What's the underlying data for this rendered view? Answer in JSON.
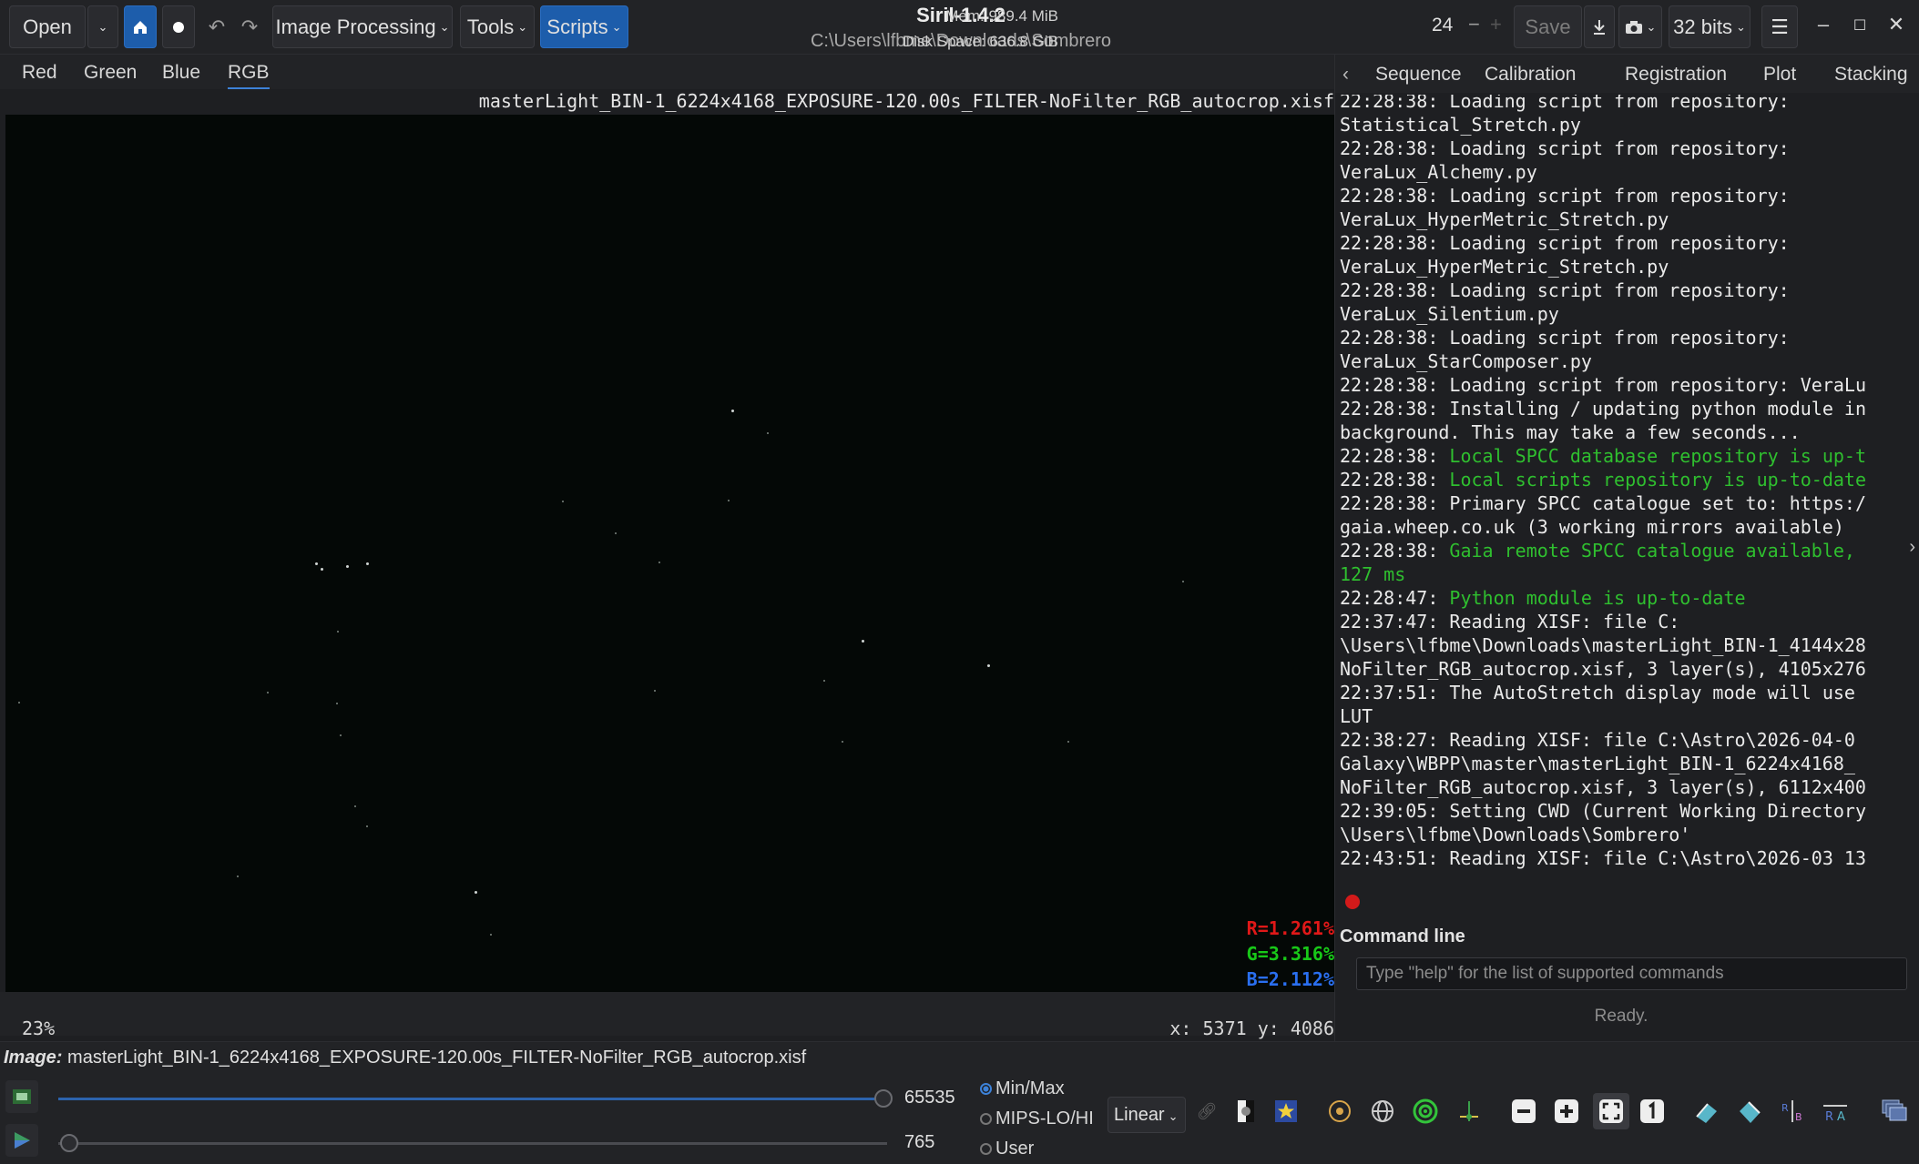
{
  "header": {
    "open_label": "Open",
    "image_processing_label": "Image Processing",
    "tools_label": "Tools",
    "scripts_label": "Scripts",
    "title": "Siril-1.4.2",
    "path": "C:\\Users\\lfbme\\Downloads\\Sombrero",
    "mem": "Mem: 989.4 MiB",
    "disk": "Disk Space: 636.8 GiB",
    "spin_value": "24",
    "save_label": "Save",
    "bits_label": "32 bits"
  },
  "channel_tabs": [
    "Red",
    "Green",
    "Blue",
    "RGB"
  ],
  "image": {
    "filename": "masterLight_BIN-1_6224x4168_EXPOSURE-120.00s_FILTER-NoFilter_RGB_autocrop.xisf",
    "r_pct": "R=1.261%",
    "g_pct": "G=3.316%",
    "b_pct": "B=2.112%",
    "zoom": "23%",
    "coords": "x: 5371 y: 4086"
  },
  "panel": {
    "tabs": [
      "Sequence",
      "Calibration",
      "Registration",
      "Plot",
      "Stacking"
    ],
    "log": [
      {
        "time": "22:28:38: ",
        "msg": "Loading script from repository:\nStatistical_Stretch.py",
        "color": "white"
      },
      {
        "time": "22:28:38: ",
        "msg": "Loading script from repository:\nVeraLux_Alchemy.py",
        "color": "white"
      },
      {
        "time": "22:28:38: ",
        "msg": "Loading script from repository:\nVeraLux_HyperMetric_Stretch.py",
        "color": "white"
      },
      {
        "time": "22:28:38: ",
        "msg": "Loading script from repository:\nVeraLux_HyperMetric_Stretch.py",
        "color": "white"
      },
      {
        "time": "22:28:38: ",
        "msg": "Loading script from repository:\nVeraLux_Silentium.py",
        "color": "white"
      },
      {
        "time": "22:28:38: ",
        "msg": "Loading script from repository:\nVeraLux_StarComposer.py",
        "color": "white"
      },
      {
        "time": "22:28:38: ",
        "msg": "Loading script from repository: VeraLu",
        "color": "white"
      },
      {
        "time": "22:28:38: ",
        "msg": "Installing / updating python module in\nbackground. This may take a few seconds...",
        "color": "white"
      },
      {
        "time": "22:28:38: ",
        "msg": "Local SPCC database repository is up-t",
        "color": "green"
      },
      {
        "time": "22:28:38: ",
        "msg": "Local scripts repository is up-to-date",
        "color": "green"
      },
      {
        "time": "22:28:38: ",
        "msg": "Primary SPCC catalogue set to: https:/\ngaia.wheep.co.uk (3 working mirrors available)",
        "color": "white"
      },
      {
        "time": "22:28:38: ",
        "msg": "Gaia remote SPCC catalogue available,\n127 ms",
        "color": "green"
      },
      {
        "time": "22:28:47: ",
        "msg": "Python module is up-to-date",
        "color": "green"
      },
      {
        "time": "22:37:47: ",
        "msg": "Reading XISF: file C:\n\\Users\\lfbme\\Downloads\\masterLight_BIN-1_4144x28\nNoFilter_RGB_autocrop.xisf, 3 layer(s), 4105x276",
        "color": "white"
      },
      {
        "time": "22:37:51: ",
        "msg": "The AutoStretch display mode will use\nLUT",
        "color": "white"
      },
      {
        "time": "22:38:27: ",
        "msg": "Reading XISF: file C:\\Astro\\2026-04-0\nGalaxy\\WBPP\\master\\masterLight_BIN-1_6224x4168_\nNoFilter_RGB_autocrop.xisf, 3 layer(s), 6112x400",
        "color": "white"
      },
      {
        "time": "22:39:05: ",
        "msg": "Setting CWD (Current Working Directory\n\\Users\\lfbme\\Downloads\\Sombrero'",
        "color": "white"
      },
      {
        "time": "22:43:51: ",
        "msg": "Reading XISF: file C:\\Astro\\2026-03 13",
        "color": "white"
      }
    ],
    "command_line_label": "Command line",
    "command_placeholder": "Type \"help\" for the list of supported commands",
    "status": "Ready."
  },
  "bottom": {
    "image_label": "Image:",
    "image_name": "masterLight_BIN-1_6224x4168_EXPOSURE-120.00s_FILTER-NoFilter_RGB_autocrop.xisf",
    "hi_value": "65535",
    "lo_value": "765",
    "hi_fraction": 1.0,
    "lo_fraction": 0.0,
    "radio_minmax": "Min/Max",
    "radio_mips": "MIPS-LO/HI",
    "radio_user": "User",
    "stretch_mode": "Linear"
  },
  "colors": {
    "accent": "#1d5dab",
    "red_pct": "#e01818",
    "green_pct": "#18c818",
    "blue_pct": "#2a6ff0",
    "log_green": "#2fbf2f"
  }
}
